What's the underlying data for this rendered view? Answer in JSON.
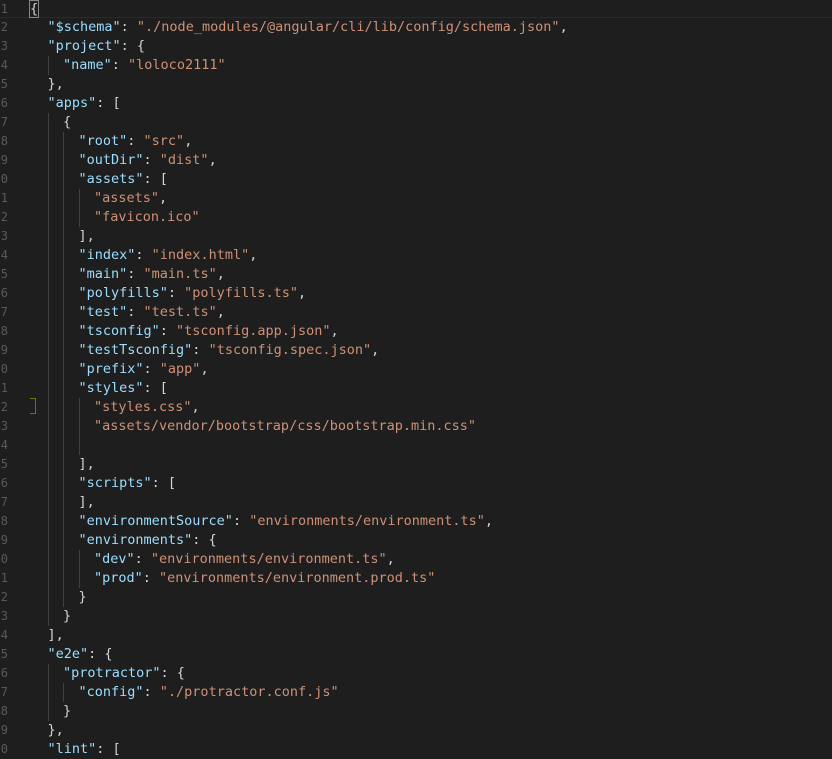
{
  "editor": {
    "language": "json",
    "colors": {
      "background": "#1e1e1e",
      "key": "#9cdcfe",
      "string": "#ce9178",
      "punctuation": "#d4d4d4",
      "line_number": "#5a5a5a"
    },
    "lines": [
      {
        "num": "1",
        "indent": 0,
        "code": "{"
      },
      {
        "num": "2",
        "indent": 1,
        "code": "\"$schema\": \"./node_modules/@angular/cli/lib/config/schema.json\","
      },
      {
        "num": "3",
        "indent": 1,
        "code": "\"project\": {"
      },
      {
        "num": "4",
        "indent": 2,
        "code": "\"name\": \"loloco2111\""
      },
      {
        "num": "5",
        "indent": 1,
        "code": "},"
      },
      {
        "num": "6",
        "indent": 1,
        "code": "\"apps\": ["
      },
      {
        "num": "7",
        "indent": 2,
        "code": "{"
      },
      {
        "num": "8",
        "indent": 3,
        "code": "\"root\": \"src\","
      },
      {
        "num": "9",
        "indent": 3,
        "code": "\"outDir\": \"dist\","
      },
      {
        "num": "0",
        "indent": 3,
        "code": "\"assets\": ["
      },
      {
        "num": "1",
        "indent": 4,
        "code": "\"assets\","
      },
      {
        "num": "2",
        "indent": 4,
        "code": "\"favicon.ico\""
      },
      {
        "num": "3",
        "indent": 3,
        "code": "],"
      },
      {
        "num": "4",
        "indent": 3,
        "code": "\"index\": \"index.html\","
      },
      {
        "num": "5",
        "indent": 3,
        "code": "\"main\": \"main.ts\","
      },
      {
        "num": "6",
        "indent": 3,
        "code": "\"polyfills\": \"polyfills.ts\","
      },
      {
        "num": "7",
        "indent": 3,
        "code": "\"test\": \"test.ts\","
      },
      {
        "num": "8",
        "indent": 3,
        "code": "\"tsconfig\": \"tsconfig.app.json\","
      },
      {
        "num": "9",
        "indent": 3,
        "code": "\"testTsconfig\": \"tsconfig.spec.json\","
      },
      {
        "num": "0",
        "indent": 3,
        "code": "\"prefix\": \"app\","
      },
      {
        "num": "1",
        "indent": 3,
        "code": "\"styles\": ["
      },
      {
        "num": "2",
        "indent": 4,
        "code": "\"styles.css\","
      },
      {
        "num": "3",
        "indent": 4,
        "code": "\"assets/vendor/bootstrap/css/bootstrap.min.css\""
      },
      {
        "num": "4",
        "indent": 4,
        "code": ""
      },
      {
        "num": "5",
        "indent": 3,
        "code": "],"
      },
      {
        "num": "6",
        "indent": 3,
        "code": "\"scripts\": ["
      },
      {
        "num": "7",
        "indent": 3,
        "code": "],"
      },
      {
        "num": "8",
        "indent": 3,
        "code": "\"environmentSource\": \"environments/environment.ts\","
      },
      {
        "num": "9",
        "indent": 3,
        "code": "\"environments\": {"
      },
      {
        "num": "0",
        "indent": 4,
        "code": "\"dev\": \"environments/environment.ts\","
      },
      {
        "num": "1",
        "indent": 4,
        "code": "\"prod\": \"environments/environment.prod.ts\""
      },
      {
        "num": "2",
        "indent": 3,
        "code": "}"
      },
      {
        "num": "3",
        "indent": 2,
        "code": "}"
      },
      {
        "num": "4",
        "indent": 1,
        "code": "],"
      },
      {
        "num": "5",
        "indent": 1,
        "code": "\"e2e\": {"
      },
      {
        "num": "6",
        "indent": 2,
        "code": "\"protractor\": {"
      },
      {
        "num": "7",
        "indent": 3,
        "code": "\"config\": \"./protractor.conf.js\""
      },
      {
        "num": "8",
        "indent": 2,
        "code": "}"
      },
      {
        "num": "9",
        "indent": 1,
        "code": "},"
      },
      {
        "num": "0",
        "indent": 1,
        "code": "\"lint\": ["
      }
    ]
  }
}
